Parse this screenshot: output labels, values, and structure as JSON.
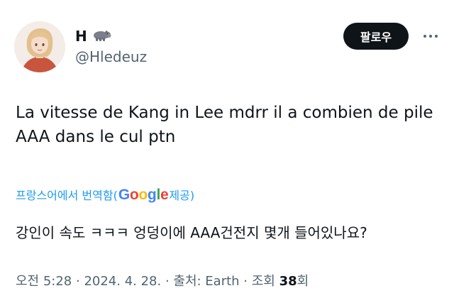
{
  "author": {
    "display_name": "H",
    "handle": "@Hledeuz",
    "name_emoji_icon": "hippo-icon"
  },
  "actions": {
    "follow_label": "팔로우",
    "more_icon": "more-horizontal-icon"
  },
  "tweet": {
    "text": "La vitesse de Kang in Lee mdrr il a combien de pile AAA dans le cul ptn",
    "translation": {
      "label_prefix": "프랑스어에서 번역함(",
      "provider_letters": [
        "G",
        "o",
        "o",
        "g",
        "l",
        "e"
      ],
      "provider_colors": [
        "#4285F4",
        "#EA4335",
        "#FBBC05",
        "#4285F4",
        "#34A853",
        "#EA4335"
      ],
      "label_suffix": " 제공)",
      "translated_text": "강인이 속도 ㅋㅋㅋ 엉덩이에 AAA건전지 몇개 들어있나요?"
    },
    "meta": {
      "time": "오전 5:28",
      "separator": " · ",
      "date": "2024. 4. 28.",
      "source": "출처: Earth",
      "views_label": "조회 ",
      "views_count": "38",
      "views_suffix": "회"
    }
  },
  "colors": {
    "follow_button_bg": "#0f1419",
    "link_blue": "#1d9bf0",
    "secondary_text": "#536471"
  }
}
